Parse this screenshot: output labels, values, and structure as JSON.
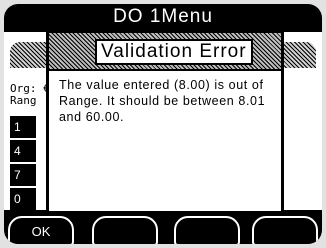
{
  "screen": {
    "title": "DO 1Menu",
    "background_fields": {
      "org_label": "Org: €",
      "range_label": "Rang"
    },
    "keypad": [
      "1",
      "4",
      "7",
      "0"
    ]
  },
  "softkeys": [
    "OK",
    "",
    "",
    ""
  ],
  "dialog": {
    "title": "Validation Error",
    "message": "The value entered (8.00) is out of Range. It should be between 8.01 and 60.00."
  },
  "colors": {
    "foreground": "#000000",
    "background": "#ffffff"
  }
}
